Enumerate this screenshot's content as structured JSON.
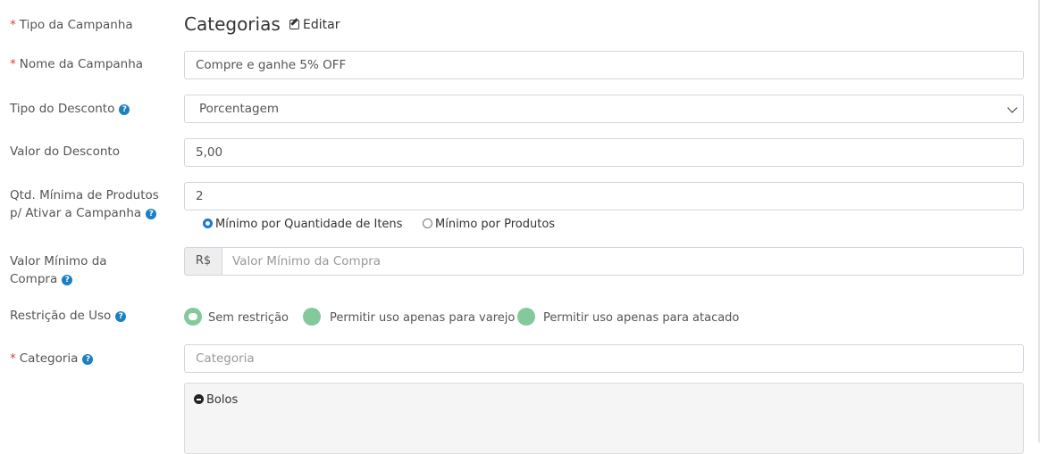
{
  "form": {
    "campaign_type": {
      "label": "Tipo da Campanha",
      "required_mark": "*",
      "value": "Categorias",
      "edit_label": "Editar"
    },
    "campaign_name": {
      "label": "Nome da Campanha",
      "required_mark": "*",
      "value": "Compre e ganhe 5% OFF"
    },
    "discount_type": {
      "label": "Tipo do Desconto",
      "help_icon": "question-circle-icon",
      "selected": "Porcentagem"
    },
    "discount_value": {
      "label": "Valor do Desconto",
      "value": "5,00"
    },
    "min_products": {
      "label_line1": "Qtd. Mínima de Produtos",
      "label_line2": "p/ Ativar a Campanha",
      "value": "2",
      "options": [
        {
          "label": "Mínimo por Quantidade de Itens",
          "checked": true
        },
        {
          "label": "Mínimo por Produtos",
          "checked": false
        }
      ]
    },
    "min_purchase": {
      "label_line1": "Valor Mínimo da",
      "label_line2": "Compra",
      "addon": "R$",
      "placeholder": "Valor Mínimo da Compra",
      "value": ""
    },
    "usage_restriction": {
      "label": "Restrição de Uso",
      "options": [
        {
          "label": "Sem restrição",
          "selected": true
        },
        {
          "label": "Permitir uso apenas para varejo",
          "selected": false
        },
        {
          "label": "Permitir uso apenas para atacado",
          "selected": false
        }
      ]
    },
    "category": {
      "label": "Categoria",
      "required_mark": "*",
      "placeholder": "Categoria",
      "tree": [
        {
          "label": "Bolos",
          "expanded": true
        }
      ]
    }
  },
  "colors": {
    "required": "#e03b3b",
    "help_icon": "#1c7fc1",
    "toggle": "#84c99c",
    "radio_checked": "#1a73e8"
  }
}
